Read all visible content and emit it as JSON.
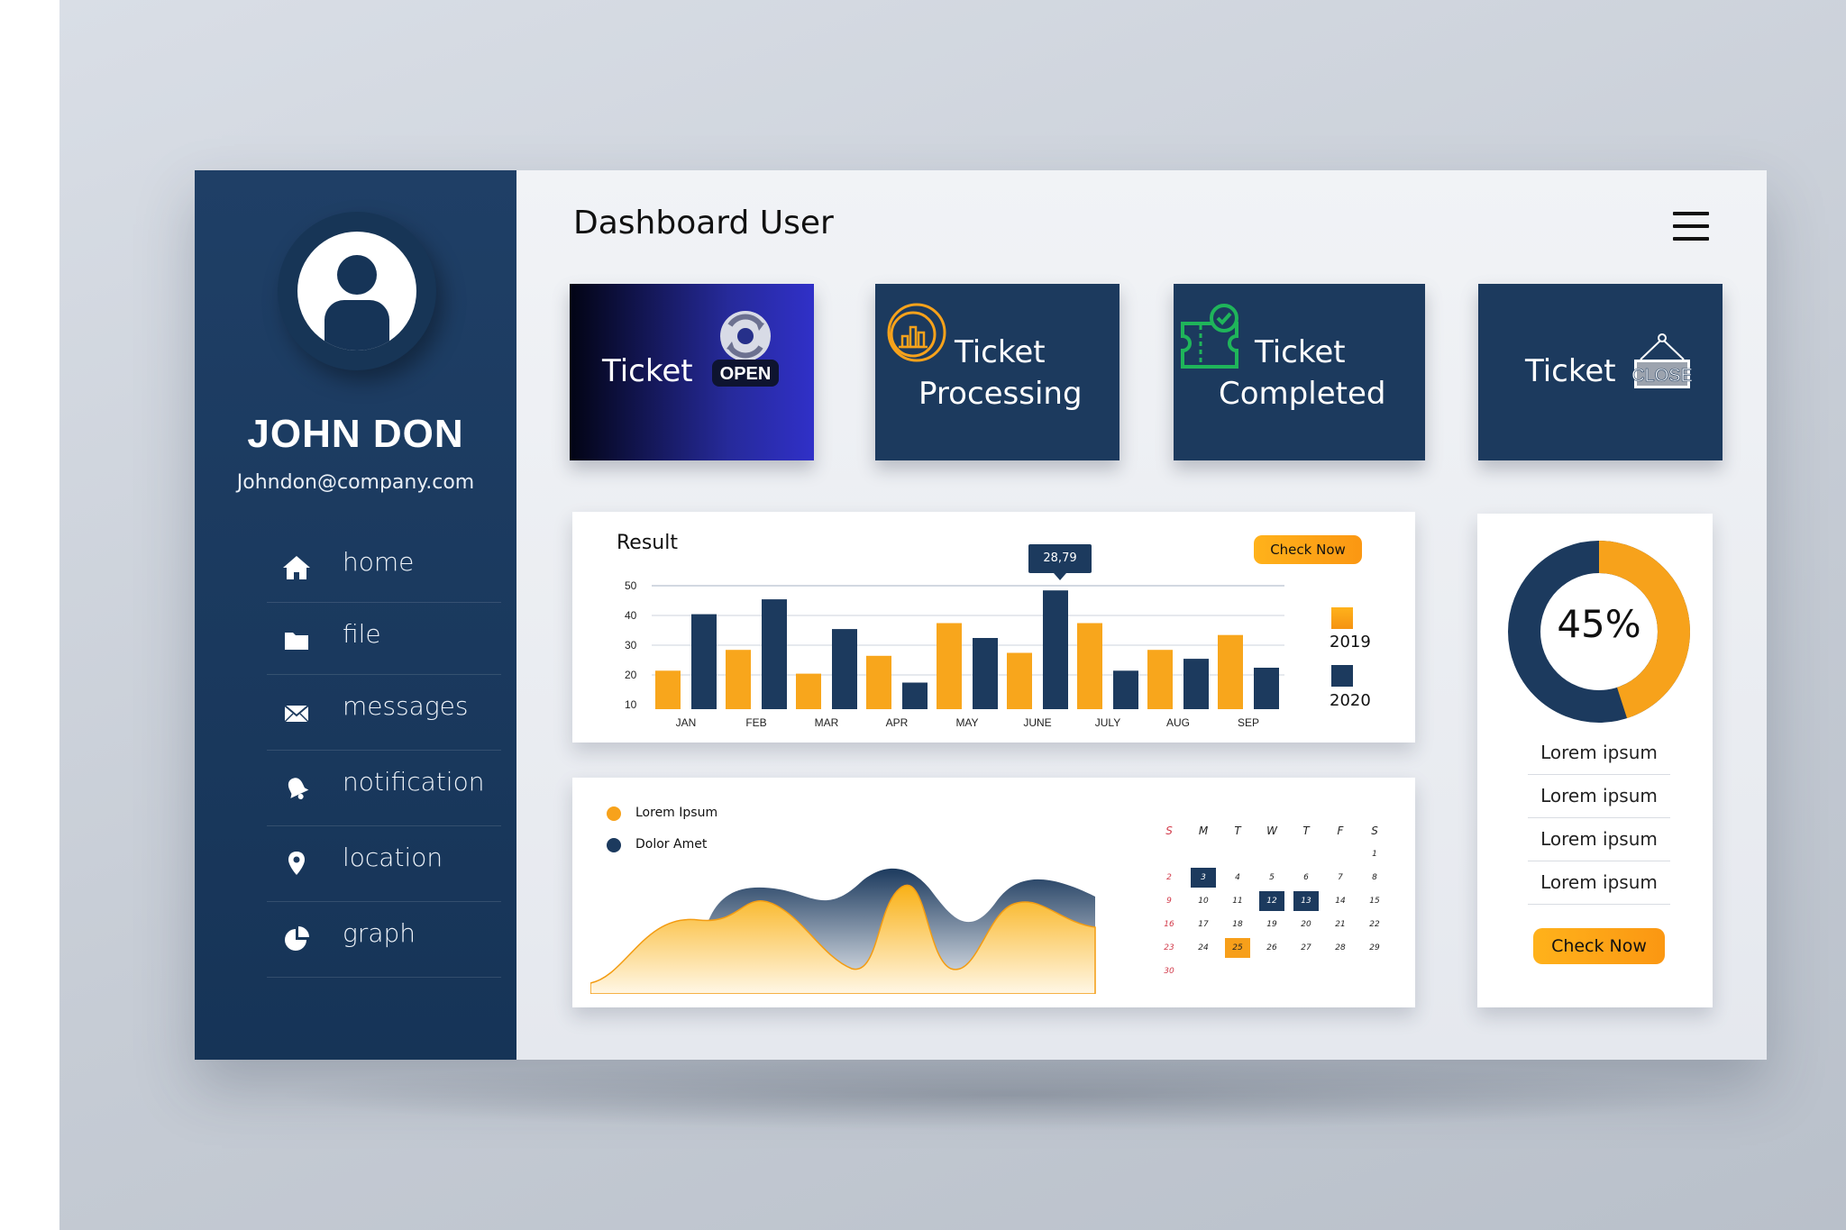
{
  "user": {
    "name": "JOHN DON",
    "email": "Johndon@company.com"
  },
  "nav": [
    {
      "label": "home",
      "icon": "home-icon"
    },
    {
      "label": "file",
      "icon": "folder-icon"
    },
    {
      "label": "messages",
      "icon": "envelope-icon"
    },
    {
      "label": "notification",
      "icon": "bell-icon"
    },
    {
      "label": "location",
      "icon": "location-pin-icon"
    },
    {
      "label": "graph",
      "icon": "pie-chart-icon"
    }
  ],
  "header": {
    "title": "Dashboard User",
    "menu_icon": "hamburger-menu-icon"
  },
  "tiles": {
    "open": {
      "line1": "Ticket",
      "badge": "OPEN"
    },
    "processing": {
      "line1": "Ticket",
      "line2": "Processing"
    },
    "completed": {
      "line1": "Ticket",
      "line2": "Completed"
    },
    "close": {
      "line1": "Ticket",
      "badge": "CLOSE"
    }
  },
  "result_card": {
    "title": "Result",
    "button": "Check Now",
    "tooltip": "28,79"
  },
  "chart_data": [
    {
      "type": "bar",
      "title": "Result",
      "categories": [
        "JAN",
        "FEB",
        "MAR",
        "APR",
        "MAY",
        "JUNE",
        "JULY",
        "AUG",
        "SEP"
      ],
      "series": [
        {
          "name": "2019",
          "color": "#f7a21b",
          "values": [
            19,
            26,
            18,
            24,
            35,
            25,
            35,
            26,
            31
          ]
        },
        {
          "name": "2020",
          "color": "#1c3a5e",
          "values": [
            38,
            43,
            33,
            15,
            30,
            46,
            19,
            23,
            20
          ]
        }
      ],
      "yticks": [
        10,
        20,
        30,
        40,
        50
      ],
      "ylim": [
        10,
        50
      ],
      "grid": true,
      "legend": "right",
      "annotation": {
        "category": "JUNE",
        "text": "28,79"
      }
    },
    {
      "type": "area",
      "series": [
        {
          "name": "Lorem Ipsum",
          "color": "#f9b91a"
        },
        {
          "name": "Dolor Amet",
          "color": "#1c3a5e"
        }
      ],
      "legend": "top-left"
    },
    {
      "type": "pie",
      "values": [
        45,
        55
      ],
      "label": "45%",
      "colors": [
        "#f7a21b",
        "#1c3a5e"
      ]
    }
  ],
  "area_card": {
    "legend": [
      "Lorem Ipsum",
      "Dolor Amet"
    ]
  },
  "calendar": {
    "days": [
      "S",
      "M",
      "T",
      "W",
      "T",
      "F",
      "S"
    ],
    "weeks": [
      [
        "",
        "",
        "",
        "",
        "",
        "",
        "1"
      ],
      [
        "2",
        "3",
        "4",
        "5",
        "6",
        "7",
        "8"
      ],
      [
        "9",
        "10",
        "11",
        "12",
        "13",
        "14",
        "15"
      ],
      [
        "16",
        "17",
        "18",
        "19",
        "20",
        "21",
        "22"
      ],
      [
        "23",
        "24",
        "25",
        "26",
        "27",
        "28",
        "29"
      ],
      [
        "30",
        "",
        "",
        "",
        "",
        "",
        ""
      ]
    ],
    "highlight_dark": [
      "3",
      "12",
      "13"
    ],
    "highlight_orange": [
      "25"
    ]
  },
  "donut_card": {
    "percent_label": "45%",
    "items": [
      "Lorem ipsum",
      "Lorem ipsum",
      "Lorem ipsum",
      "Lorem ipsum"
    ],
    "button": "Check Now"
  },
  "colors": {
    "navy": "#1c3a5e",
    "orange": "#f7a21b",
    "purple": "#2b2fb8"
  }
}
